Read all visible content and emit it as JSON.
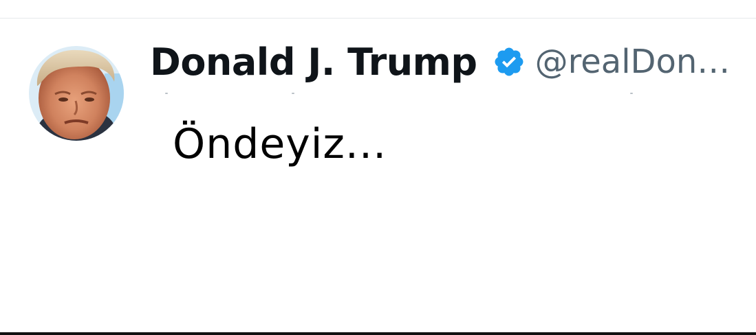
{
  "tweet": {
    "author": {
      "display_name": "Donald J. Trump",
      "handle": "@realDon…",
      "verified": true,
      "verified_badge_icon": "verified-check-icon",
      "avatar_icon": "profile-photo"
    },
    "text": "Öndeyiz..."
  },
  "colors": {
    "name": "#0f1419",
    "handle": "#536471",
    "verified": "#1d9bf0",
    "text": "#000000",
    "background": "#ffffff"
  }
}
